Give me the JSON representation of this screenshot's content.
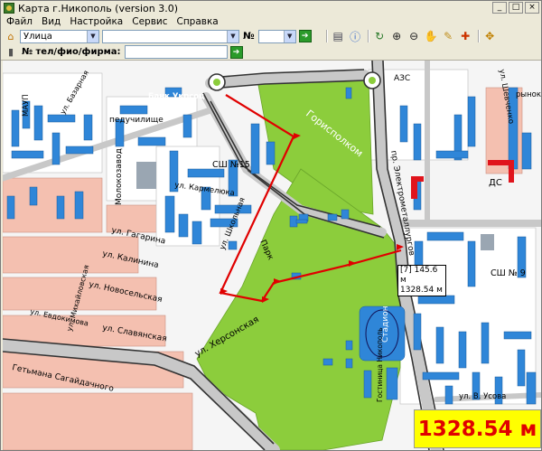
{
  "window": {
    "title": "Карта г.Никополь (version 3.0)",
    "minimize": "_",
    "maximize": "□",
    "close": "×"
  },
  "menu": {
    "items": [
      "Файл",
      "Вид",
      "Настройка",
      "Сервис",
      "Справка"
    ]
  },
  "toolbar": {
    "street_type": "Улица",
    "street_name": "",
    "number_label": "№",
    "number_value": "",
    "search_label": "№ тел/фио/фирма:",
    "search_value": "",
    "go": "➔"
  },
  "map": {
    "labels": {
      "bank": "Банк Укрсоц",
      "school_aside": "педучилище",
      "molokozavod": "Молокозавод",
      "gorispolkom": "Горисполком",
      "azs": "АЗС",
      "park": "Парк",
      "stadion": "Стадион",
      "gostinica": "Гостиница Никополь",
      "ds": "ДС",
      "sch15": "СШ №15",
      "sch9": "СШ № 9",
      "rynok": "рынок",
      "maup": "МАУП"
    },
    "streets": {
      "gagarina": "ул. Гагарина",
      "kalinina": "ул. Калинина",
      "novoselskaya": "ул. Новосельская",
      "slavyanskaya": "ул. Славянская",
      "hersonskaya": "ул. Херсонская",
      "getmana": "Гетьмана Сагайдачного",
      "elektrometallurgov": "пр. Электрометаллургов",
      "shevchenko": "ул. Шевченко",
      "usova": "ул. В. Усова",
      "karmeleuka": "ул. Кармелюка",
      "shkolnaya": "ул. Школьная",
      "bazarnaya": "ул. Базарная",
      "evdokimova": "ул. Евдокимова",
      "mixajlovskaya": "ул. Михайловская"
    }
  },
  "measure": {
    "tooltip_line1": "[7] 145.6 м",
    "tooltip_line2": "1328.54 м",
    "total": "1328.54 м"
  }
}
